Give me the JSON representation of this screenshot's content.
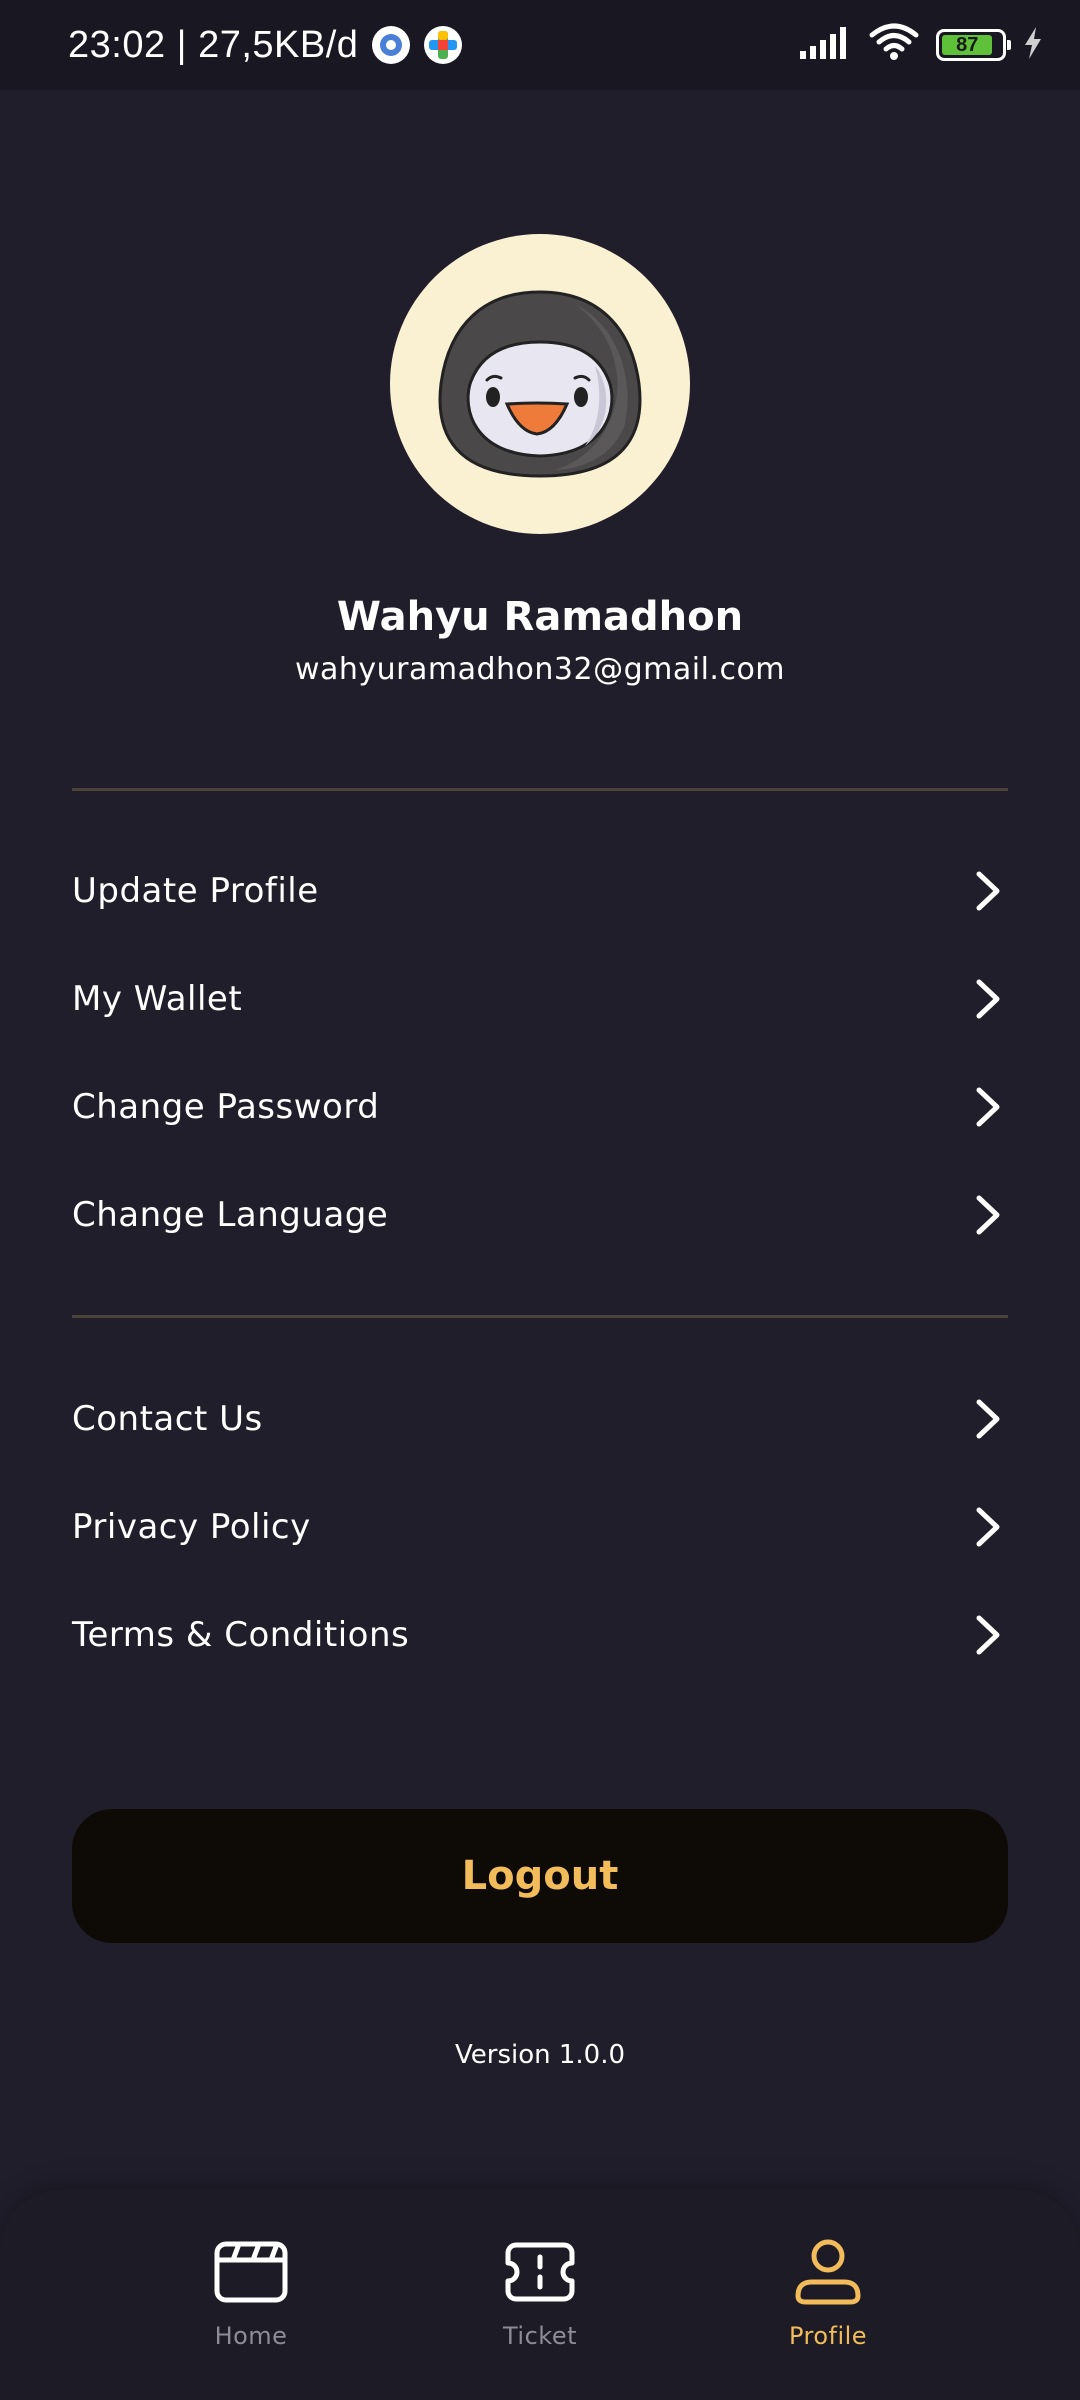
{
  "status_bar": {
    "time_and_speed": "23:02 | 27,5KB/d",
    "battery_level": "87",
    "battery_color": "#5fc03a"
  },
  "profile": {
    "name": "Wahyu Ramadhon",
    "email": "wahyuramadhon32@gmail.com",
    "avatar_icon": "penguin-avatar"
  },
  "menu": {
    "section1": [
      {
        "label": "Update Profile"
      },
      {
        "label": "My Wallet"
      },
      {
        "label": "Change Password"
      },
      {
        "label": "Change Language"
      }
    ],
    "section2": [
      {
        "label": "Contact Us"
      },
      {
        "label": "Privacy Policy"
      },
      {
        "label": "Terms & Conditions"
      }
    ]
  },
  "logout": {
    "label": "Logout",
    "text_color": "#f3bc5a"
  },
  "version": "Version 1.0.0",
  "nav": {
    "items": [
      {
        "label": "Home",
        "icon": "clapperboard-icon"
      },
      {
        "label": "Ticket",
        "icon": "ticket-icon"
      },
      {
        "label": "Profile",
        "icon": "user-icon",
        "active": true
      }
    ],
    "accent": "#f3bc5a"
  }
}
